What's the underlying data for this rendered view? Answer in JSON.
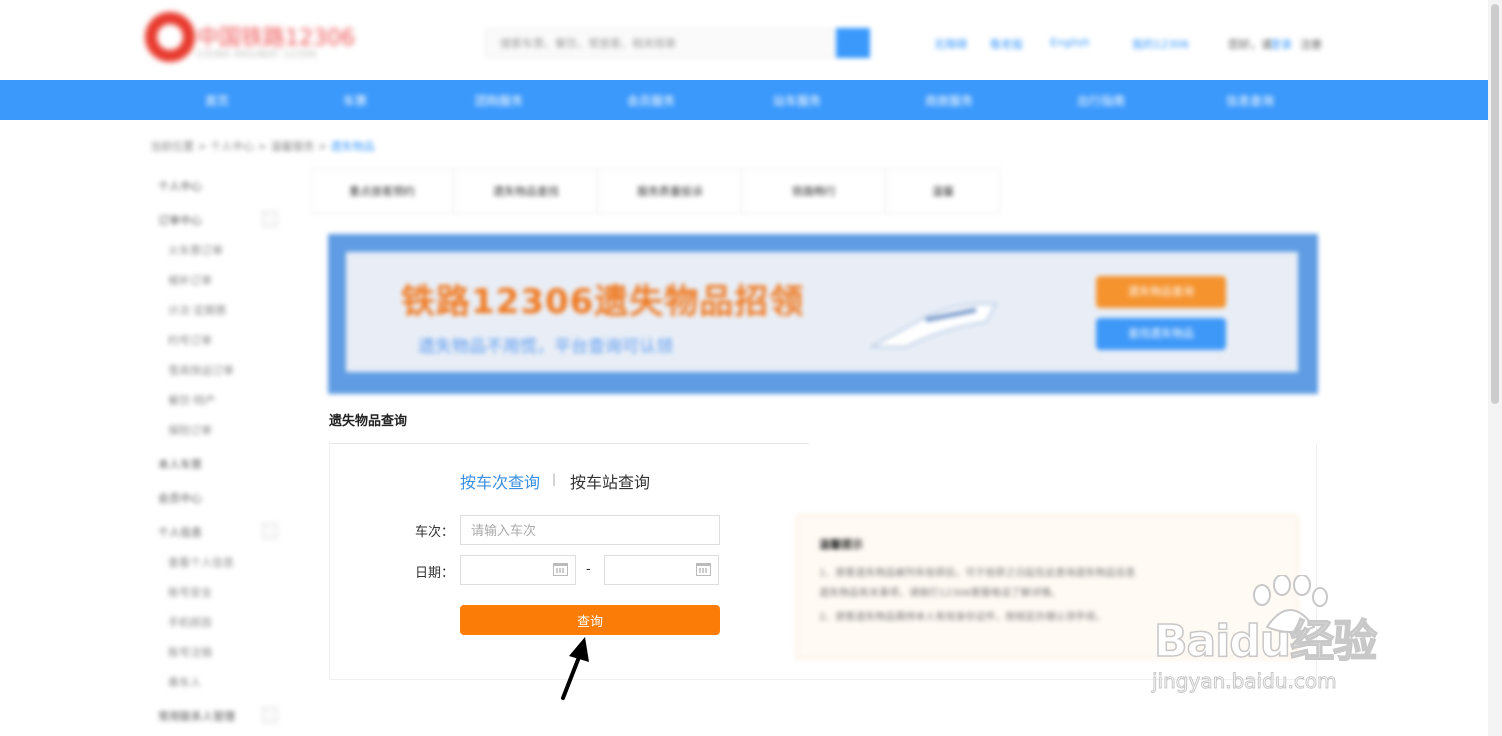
{
  "header": {
    "logo_text": "中国铁路12306",
    "logo_sub": "CHINA RAILWAY 12306",
    "search_placeholder": "搜索车票、餐饮、常旅客、相关规章",
    "links": [
      "无障碍",
      "敬老版",
      "English",
      "我的12306",
      "您好，请",
      "登录",
      "注册"
    ]
  },
  "nav": {
    "items": [
      "首页",
      "车票",
      "团购服务",
      "会员服务",
      "站车服务",
      "商旅服务",
      "出行指南",
      "信息查询"
    ]
  },
  "breadcrumb": {
    "items": [
      "当前位置",
      "个人中心",
      "温馨服务"
    ],
    "current": "遗失物品"
  },
  "sidebar": {
    "items": [
      {
        "label": "个人中心",
        "sub": false
      },
      {
        "label": "订单中心",
        "sub": false
      },
      {
        "label": "火车票订单",
        "sub": true
      },
      {
        "label": "候补订单",
        "sub": true
      },
      {
        "label": "计次·定期票",
        "sub": true
      },
      {
        "label": "约号订单",
        "sub": true
      },
      {
        "label": "雪具快运订单",
        "sub": true
      },
      {
        "label": "餐饮·特产",
        "sub": true
      },
      {
        "label": "保险订单",
        "sub": true
      },
      {
        "label": "本人车票",
        "sub": false
      },
      {
        "label": "会员中心",
        "sub": false
      },
      {
        "label": "个人信息",
        "sub": false
      },
      {
        "label": "查看个人信息",
        "sub": true
      },
      {
        "label": "账号安全",
        "sub": true
      },
      {
        "label": "手机核验",
        "sub": true
      },
      {
        "label": "账号注销",
        "sub": true
      },
      {
        "label": "乘车人",
        "sub": true
      },
      {
        "label": "常用联系人管理",
        "sub": false
      }
    ]
  },
  "top_tabs": [
    "重点旅客预约",
    "遗失物品查找",
    "服务质量投诉",
    "铁路畅行",
    "温馨"
  ],
  "banner": {
    "title": "铁路12306遗失物品招领",
    "subtitle": "遗失物品不用慌，平台查询可认领",
    "btn_primary": "遗失物品查询",
    "btn_secondary": "查找遗失物品"
  },
  "section": {
    "title": "遗失物品查询"
  },
  "query": {
    "tab_train": "按车次查询",
    "tab_sep": "|",
    "tab_station": "按车站查询",
    "train_label": "车次：",
    "train_placeholder": "请输入车次",
    "date_label": "日期：",
    "date_dash": "-",
    "submit_label": "查询"
  },
  "tips": {
    "title": "温馨提示",
    "lines": [
      "1、旅客遗失物品被列车拾获后，可于拾获之日起在此查询遗失物品信息",
      "遗失物品有关事项，请拨打12306客服电话了解详情。",
      "2、旅客遗失物品需持本人有效身份证件，按规定办理认领手续。"
    ]
  },
  "watermark": {
    "brand": "Baidu经验",
    "url": "jingyan.baidu.com"
  },
  "colors": {
    "accent_blue": "#3b99fc",
    "query_orange": "#fb7d07",
    "banner_title_orange": "#f0781e"
  }
}
